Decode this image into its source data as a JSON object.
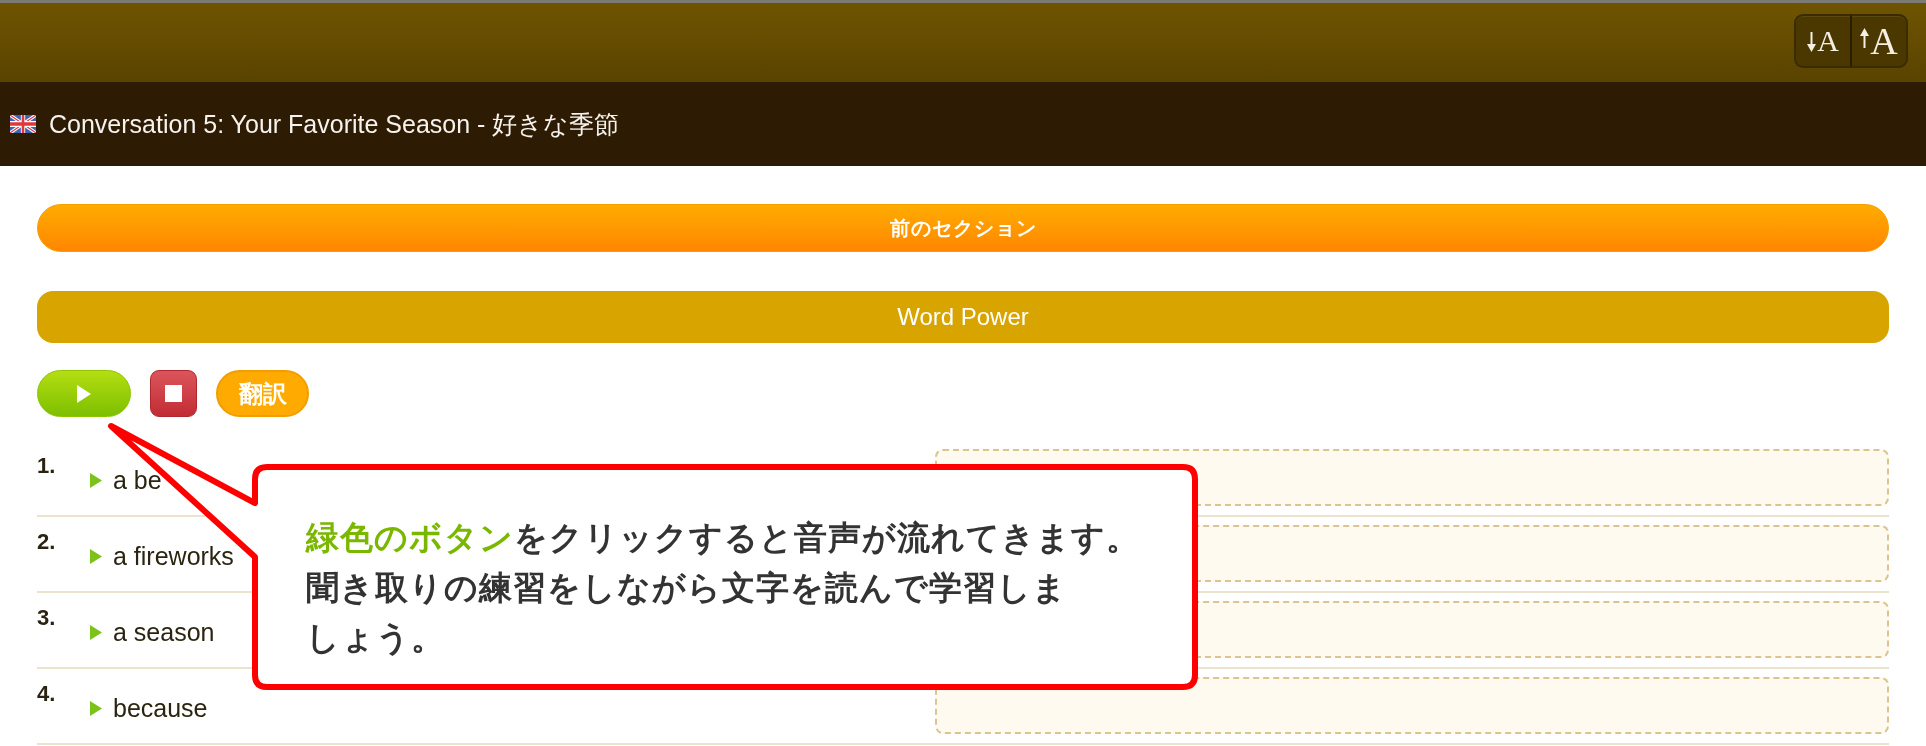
{
  "header": {
    "font_buttons": [
      {
        "kind": "decrease",
        "label": "A"
      },
      {
        "kind": "increase",
        "label": "A"
      }
    ]
  },
  "title_bar": {
    "title": "Conversation 5: Your Favorite Season - 好きな季節"
  },
  "previous_section_button": {
    "label": "前のセクション"
  },
  "section_header": {
    "title": "Word Power"
  },
  "audio_controls": [
    {
      "kind": "play"
    },
    {
      "kind": "stop"
    },
    {
      "kind": "translate",
      "label": "翻訳"
    }
  ],
  "words": [
    {
      "number": "1.",
      "word": "a be"
    },
    {
      "number": "2.",
      "word": "a fireworks"
    },
    {
      "number": "3.",
      "word": "a season"
    },
    {
      "number": "4.",
      "word": "because"
    }
  ],
  "callout": {
    "paragraphs": [
      [
        {
          "text": "緑色のボタン",
          "highlight": true
        },
        {
          "text": "をクリックすると音声が流れてきます。",
          "highlight": false
        }
      ],
      [
        {
          "text": "聞き取りの練習をしながら文字を読んで学習しましょう。",
          "highlight": false
        }
      ]
    ]
  }
}
